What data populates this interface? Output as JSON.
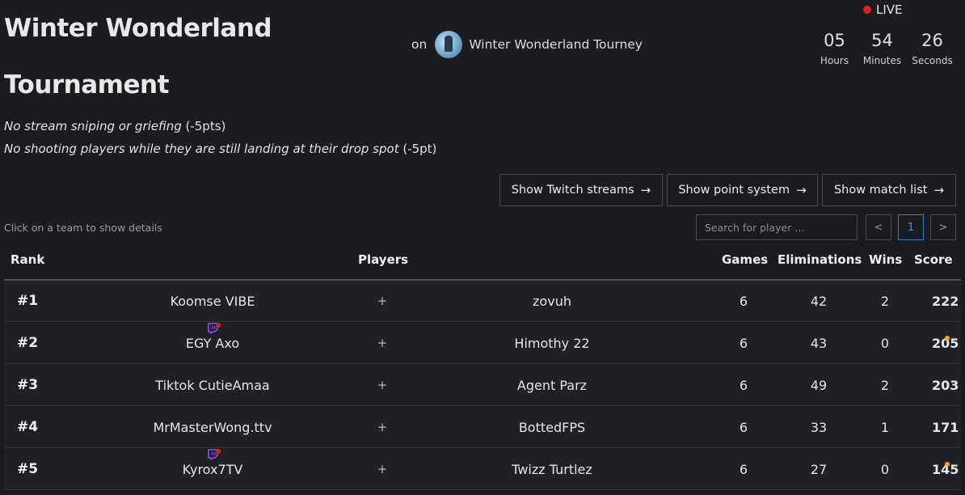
{
  "header": {
    "title": "Winter Wonderland Tournament",
    "host_prefix": "on",
    "host_name": "Winter Wonderland Tourney",
    "host_logo_icon": "tournament-logo-icon",
    "live_label": "LIVE",
    "live_color": "#e01e1e"
  },
  "countdown": {
    "hours": "05",
    "hours_label": "Hours",
    "minutes": "54",
    "minutes_label": "Minutes",
    "seconds": "26",
    "seconds_label": "Seconds"
  },
  "rules": [
    {
      "text": "No stream sniping or griefing",
      "penalty": " (-5pts)"
    },
    {
      "text": "No shooting players while they are still landing at their drop spot",
      "penalty": " (-5pt)"
    }
  ],
  "buttons": {
    "twitch_streams": "Show Twitch streams",
    "point_system": "Show point system",
    "match_list": "Show match list",
    "arrow_icon": "arrow-right-icon"
  },
  "controls": {
    "hint": "Click on a team to show details",
    "search_placeholder": "Search for player ...",
    "prev": "<",
    "page": "1",
    "next": ">",
    "active_color": "#3b7bd4"
  },
  "table": {
    "headers": {
      "rank": "Rank",
      "players": "Players",
      "games": "Games",
      "eliminations": "Eliminations",
      "wins": "Wins",
      "score": "Score"
    },
    "rows": [
      {
        "rank": "#1",
        "player1": "Koomse VIBE",
        "player1_twitch": false,
        "plus": "+",
        "player2": "zovuh",
        "games": "6",
        "eliminations": "42",
        "wins": "2",
        "score": "222",
        "score_dot": false
      },
      {
        "rank": "#2",
        "player1": "EGY Axo",
        "player1_twitch": true,
        "plus": "+",
        "player2": "Himothy 22",
        "games": "6",
        "eliminations": "43",
        "wins": "0",
        "score": "205",
        "score_dot": true
      },
      {
        "rank": "#3",
        "player1": "Tiktok CutieAmaa",
        "player1_twitch": false,
        "plus": "+",
        "player2": "Agent Parz",
        "games": "6",
        "eliminations": "49",
        "wins": "2",
        "score": "203",
        "score_dot": false
      },
      {
        "rank": "#4",
        "player1": "MrMasterWong.ttv",
        "player1_twitch": false,
        "plus": "+",
        "player2": "BottedFPS",
        "games": "6",
        "eliminations": "33",
        "wins": "1",
        "score": "171",
        "score_dot": false
      },
      {
        "rank": "#5",
        "player1": "Kyrox7TV",
        "player1_twitch": true,
        "plus": "+",
        "player2": "Twizz Turtlez",
        "games": "6",
        "eliminations": "27",
        "wins": "0",
        "score": "145",
        "score_dot": true
      }
    ],
    "twitch_color": "#9146ff",
    "score_dot_color": "#f5a623"
  }
}
